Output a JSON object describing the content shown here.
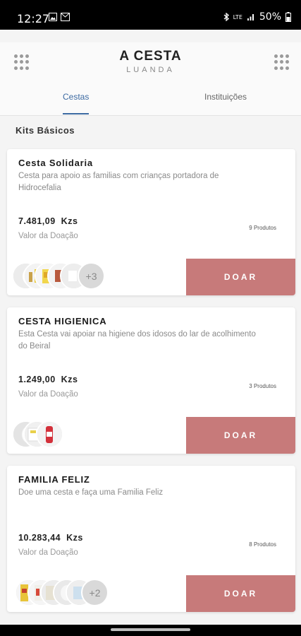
{
  "status_bar": {
    "time": "12:27",
    "network": "LTE",
    "battery": "50%"
  },
  "header": {
    "title": "A CESTA",
    "subtitle": "LUANDA",
    "tabs": [
      {
        "label": "Cestas",
        "active": true
      },
      {
        "label": "Instituições",
        "active": false
      }
    ]
  },
  "section_title": "Kits Básicos",
  "cards": [
    {
      "title": "Cesta Solidaria",
      "description": "Cesta para apoio as familias com crianças portadora de Hidrocefalia",
      "price": "7.481,09",
      "currency": "Kzs",
      "value_label": "Valor da Doação",
      "product_count": "9 Produtos",
      "more_count": "+3",
      "button_label": "DOAR"
    },
    {
      "title": "CESTA HIGIENICA",
      "description": "Esta  Cesta vai apoiar na higiene dos idosos do lar de acolhimento do Beiral",
      "price": "1.249,00",
      "currency": "Kzs",
      "value_label": "Valor da Doação",
      "product_count": "3 Produtos",
      "button_label": "DOAR"
    },
    {
      "title": "FAMILIA FELIZ",
      "description": "Doe uma cesta e faça uma Familia Feliz",
      "price": "10.283,44",
      "currency": "Kzs",
      "value_label": "Valor da Doação",
      "product_count": "8 Produtos",
      "more_count": "+2",
      "button_label": "DOAR"
    }
  ],
  "colors": {
    "accent": "#3c6aa2",
    "donate_button": "#c77a7a",
    "status_bar": "#000000"
  }
}
